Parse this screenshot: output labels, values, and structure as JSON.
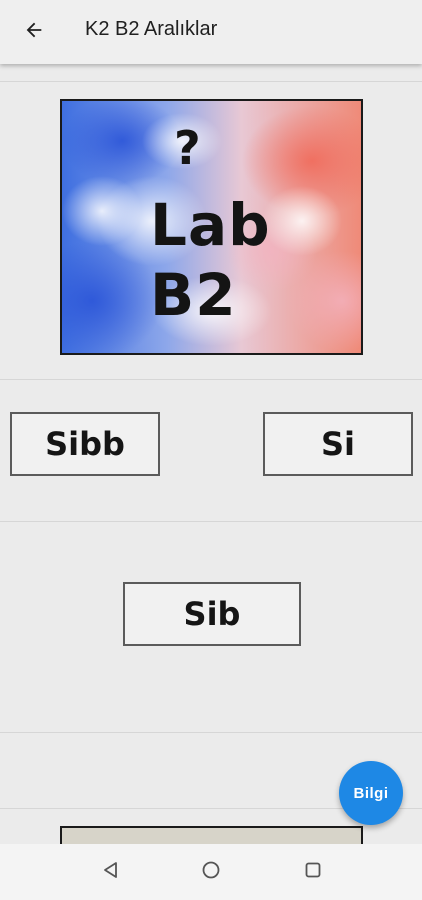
{
  "appbar": {
    "title": "K2 B2 Aralıklar",
    "back_icon": "arrow-left-icon"
  },
  "cover": {
    "question_mark": "?",
    "line1": "Lab",
    "line2": "B2"
  },
  "answers": [
    {
      "label": "Sibb"
    },
    {
      "label": "Si"
    },
    {
      "label": "Sib"
    }
  ],
  "fab": {
    "label": "Bilgi",
    "color": "#1e88e5"
  },
  "navbar": {
    "back_icon": "nav-back-icon",
    "home_icon": "nav-home-icon",
    "recents_icon": "nav-recents-icon"
  }
}
